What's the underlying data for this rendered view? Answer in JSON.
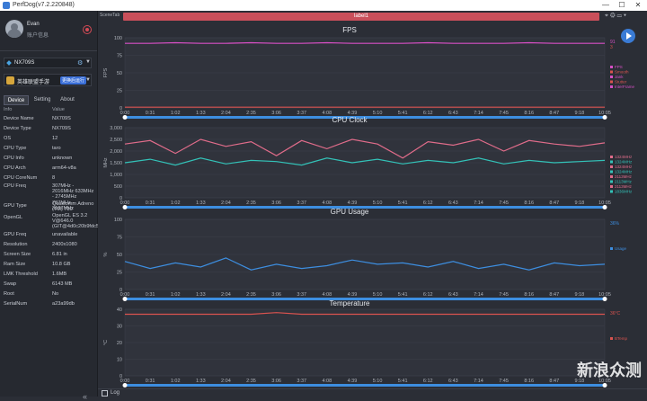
{
  "window": {
    "title": "PerfDog(v7.2.220848)",
    "minimize": "—",
    "maximize": "☐",
    "close": "✕"
  },
  "user": {
    "name": "Evan",
    "info": "账户信息"
  },
  "device": {
    "name": "NX709S"
  },
  "app": {
    "name": "英雄联盟手游",
    "badge": "更换后运行"
  },
  "tabs": [
    "Device",
    "Setting",
    "About"
  ],
  "info_header": {
    "k": "Info",
    "v": "Value"
  },
  "device_info": [
    {
      "k": "Device Name",
      "v": "NX709S"
    },
    {
      "k": "Device Type",
      "v": "NX709S"
    },
    {
      "k": "OS",
      "v": "12"
    },
    {
      "k": "CPU Type",
      "v": "taro"
    },
    {
      "k": "CPU Info",
      "v": "unknown"
    },
    {
      "k": "CPU Arch",
      "v": "arm64-v8a"
    },
    {
      "k": "CPU CoreNum",
      "v": "8"
    },
    {
      "k": "CPU Freq",
      "v": "307MHz - 2016MHz 633MHz - 2745MHz 787MHz - 3187MHz"
    },
    {
      "k": "GPU Type",
      "v": "Qualcomm Adreno (TM) 730"
    },
    {
      "k": "OpenGL",
      "v": "OpenGL ES 3.2 V@646.0 (GIT@4d0c20b9fdc5"
    },
    {
      "k": "GPU Freq",
      "v": "unavailable"
    },
    {
      "k": "Resolution",
      "v": "2400x1080"
    },
    {
      "k": "Screen Size",
      "v": "6.81 in"
    },
    {
      "k": "Ram Size",
      "v": "10.8 GB"
    },
    {
      "k": "LMK Threshold",
      "v": "1.6MB"
    },
    {
      "k": "Swap",
      "v": "6143 MB"
    },
    {
      "k": "Root",
      "v": "No"
    },
    {
      "k": "SerialNum",
      "v": "a23a99db"
    }
  ],
  "main": {
    "scene_tab": "SceneTab",
    "label": "label1",
    "log": "Log",
    "watermark": "新浪众测"
  },
  "colors": {
    "accent": "#3a7bd5",
    "label_bar": "#c94f5a",
    "fps": "#d64fc4",
    "cpu1": "#e06c8a",
    "cpu2": "#33c2b8",
    "gpu": "#3d8ee0",
    "temp": "#d9534f"
  },
  "chart_data": [
    {
      "type": "line",
      "title": "FPS",
      "ylabel": "FPS",
      "ylim": [
        0,
        100
      ],
      "yticks": [
        0,
        25,
        50,
        75,
        100
      ],
      "x": [
        "0:00",
        "0:31",
        "1:02",
        "1:33",
        "2:04",
        "2:35",
        "3:06",
        "3:37",
        "4:08",
        "4:39",
        "5:10",
        "5:41",
        "6:12",
        "6:43",
        "7:14",
        "7:45",
        "8:16",
        "8:47",
        "9:18",
        "10:05"
      ],
      "series": [
        {
          "name": "FPS",
          "values": [
            92,
            92,
            93,
            92,
            92,
            93,
            92,
            92,
            93,
            92,
            92,
            92,
            93,
            92,
            92,
            92,
            93,
            92,
            92,
            92
          ]
        },
        {
          "name": "Jank",
          "values": [
            1,
            1,
            1,
            1,
            1,
            1,
            1,
            1,
            1,
            1,
            1,
            1,
            1,
            1,
            1,
            1,
            1,
            1,
            1,
            1
          ]
        }
      ],
      "legend": [
        "FPS",
        "Smooth",
        "Jank",
        "Stutter",
        "InterFrame"
      ],
      "current": [
        "91",
        "3"
      ]
    },
    {
      "type": "line",
      "title": "CPU Clock",
      "ylabel": "MHz",
      "ylim": [
        0,
        3000
      ],
      "yticks": [
        0,
        500,
        1000,
        1500,
        2000,
        2500,
        3000
      ],
      "x": [
        "0:00",
        "0:31",
        "1:02",
        "1:33",
        "2:04",
        "2:35",
        "3:06",
        "3:37",
        "4:08",
        "4:39",
        "5:10",
        "5:41",
        "6:12",
        "6:43",
        "7:14",
        "7:45",
        "8:16",
        "8:47",
        "9:18",
        "10:05"
      ],
      "series": [
        {
          "name": "CPU big",
          "values": [
            2300,
            2450,
            1900,
            2500,
            2200,
            2400,
            1800,
            2450,
            2100,
            2500,
            2300,
            1700,
            2400,
            2250,
            2500,
            2000,
            2450,
            2300,
            2200,
            2350
          ]
        },
        {
          "name": "CPU little",
          "values": [
            1500,
            1650,
            1400,
            1700,
            1450,
            1600,
            1550,
            1400,
            1700,
            1500,
            1650,
            1450,
            1600,
            1500,
            1700,
            1450,
            1600,
            1500,
            1550,
            1600
          ]
        }
      ],
      "legend": [
        "1324MHz",
        "1324MHz",
        "1324MHz",
        "1324MHz",
        "2113MHz",
        "2113MHz",
        "2113MHz",
        "1836MHz"
      ]
    },
    {
      "type": "line",
      "title": "GPU Usage",
      "ylabel": "%",
      "ylim": [
        0,
        100
      ],
      "yticks": [
        0,
        25,
        50,
        75,
        100
      ],
      "x": [
        "0:00",
        "0:31",
        "1:02",
        "1:33",
        "2:04",
        "2:35",
        "3:06",
        "3:37",
        "4:08",
        "4:39",
        "5:10",
        "5:41",
        "6:12",
        "6:43",
        "7:14",
        "7:45",
        "8:16",
        "8:47",
        "9:18",
        "10:05"
      ],
      "series": [
        {
          "name": "Usage",
          "values": [
            40,
            30,
            38,
            32,
            45,
            28,
            36,
            30,
            34,
            42,
            36,
            38,
            32,
            40,
            30,
            36,
            28,
            38,
            34,
            36
          ]
        }
      ],
      "legend": [
        "Usage"
      ],
      "current": [
        "36%"
      ]
    },
    {
      "type": "line",
      "title": "Temperature",
      "ylabel": "°C",
      "ylim": [
        0,
        40
      ],
      "yticks": [
        0,
        10,
        20,
        30,
        40
      ],
      "x": [
        "0:00",
        "0:31",
        "1:02",
        "1:33",
        "2:04",
        "2:35",
        "3:06",
        "3:37",
        "4:08",
        "4:39",
        "5:10",
        "5:41",
        "6:12",
        "6:43",
        "7:14",
        "7:45",
        "8:16",
        "8:47",
        "9:18",
        "10:05"
      ],
      "series": [
        {
          "name": "BTemp",
          "values": [
            37,
            37,
            37,
            37,
            37,
            37,
            38,
            37,
            37,
            37,
            37,
            37,
            37,
            37,
            37,
            37,
            37,
            37,
            37,
            37
          ]
        }
      ],
      "legend": [
        "BTemp"
      ],
      "current": [
        "36°C"
      ]
    }
  ]
}
